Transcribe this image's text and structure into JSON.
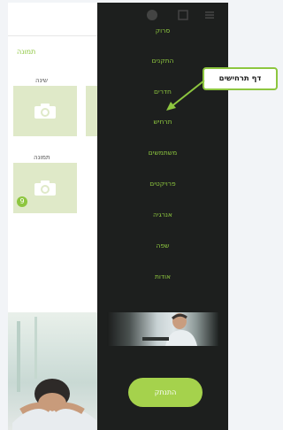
{
  "background_screen": {
    "title": "תמונה",
    "tiles": [
      {
        "label": "שינה"
      },
      {
        "label": ""
      },
      {
        "label": "תמונה"
      }
    ],
    "badge": "9"
  },
  "drawer": {
    "menu": [
      {
        "label": "סרוק"
      },
      {
        "label": "התקנים"
      },
      {
        "label": "חדרים"
      },
      {
        "label": "תרחיש"
      },
      {
        "label": "משתמשים"
      },
      {
        "label": "פרויקטים"
      },
      {
        "label": "אנרגיה"
      },
      {
        "label": "שפה"
      },
      {
        "label": "אודות"
      }
    ],
    "logout_label": "התנתק"
  },
  "callout": {
    "text": "דף תרחישים"
  },
  "colors": {
    "accent": "#8dc63f",
    "drawer_bg": "#1d1f1e",
    "logout_bg": "#a5d24c"
  }
}
